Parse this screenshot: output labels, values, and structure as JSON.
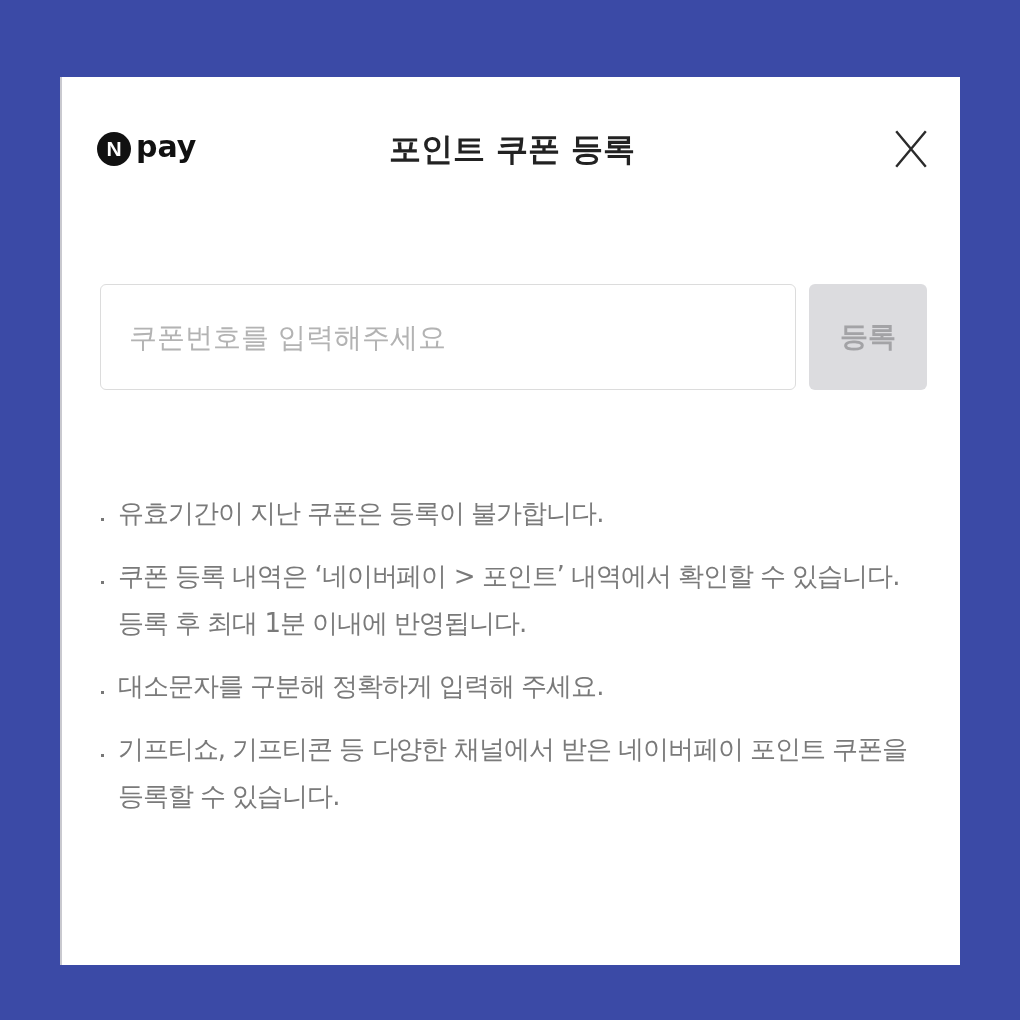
{
  "header": {
    "logo": {
      "mark": "N",
      "text": "pay"
    },
    "title": "포인트 쿠폰 등록"
  },
  "coupon_form": {
    "input": {
      "placeholder": "쿠폰번호를 입력해주세요"
    },
    "submit_button": {
      "label": "등록",
      "disabled": true
    }
  },
  "notes": [
    "유효기간이 지난 쿠폰은 등록이 불가합니다.",
    "쿠폰 등록 내역은 ‘네이버페이 > 포인트’ 내역에서 확인할 수 있습니다. 등록 후 최대 1분 이내에 반영됩니다.",
    "대소문자를 구분해 정확하게 입력해 주세요.",
    "기프티쇼, 기프티콘 등 다양한 채널에서 받은 네이버페이 포인트 쿠폰을 등록할 수 있습니다."
  ]
}
